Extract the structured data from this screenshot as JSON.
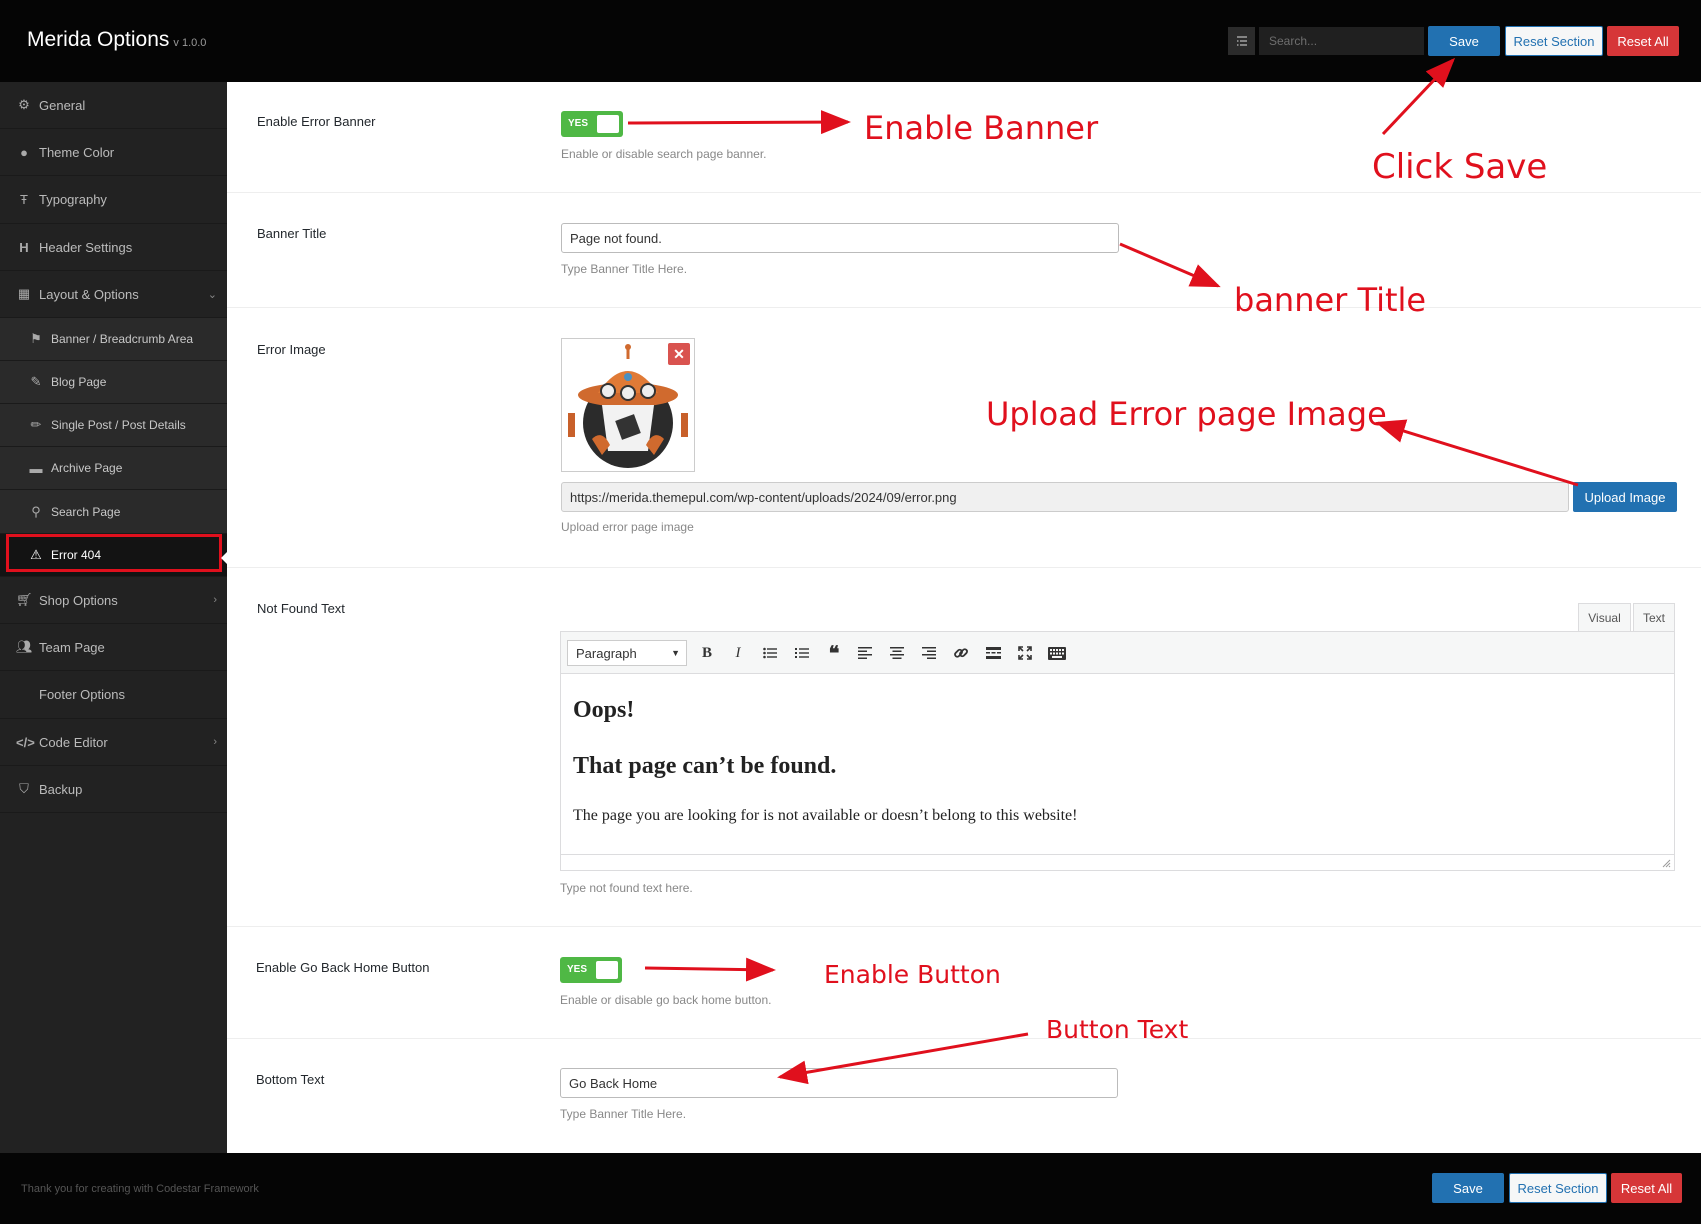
{
  "header": {
    "brand": "Merida Options",
    "version": "v 1.0.0",
    "search_placeholder": "Search...",
    "save_label": "Save",
    "reset_section_label": "Reset Section",
    "reset_all_label": "Reset All"
  },
  "sidebar": {
    "items": [
      {
        "label": "General",
        "icon": "gears-icon"
      },
      {
        "label": "Theme Color",
        "icon": "palette-icon"
      },
      {
        "label": "Typography",
        "icon": "text-height-icon"
      },
      {
        "label": "Header Settings",
        "icon": "heading-icon"
      },
      {
        "label": "Layout & Options",
        "icon": "calculator-icon"
      },
      {
        "label": "Banner / Breadcrumb Area",
        "icon": "flag-icon"
      },
      {
        "label": "Blog Page",
        "icon": "edit-icon"
      },
      {
        "label": "Single Post / Post Details",
        "icon": "pencil-icon"
      },
      {
        "label": "Archive Page",
        "icon": "archive-icon"
      },
      {
        "label": "Search Page",
        "icon": "search-icon"
      },
      {
        "label": "Error 404",
        "icon": "warning-icon"
      },
      {
        "label": "Shop Options",
        "icon": "cart-icon"
      },
      {
        "label": "Team Page",
        "icon": "users-icon"
      },
      {
        "label": "Footer Options",
        "icon": ""
      },
      {
        "label": "Code Editor",
        "icon": "code-icon"
      },
      {
        "label": "Backup",
        "icon": "shield-icon"
      }
    ]
  },
  "fields": {
    "enable_error_banner": {
      "title": "Enable Error Banner",
      "switch_label": "YES",
      "desc": "Enable or disable search page banner."
    },
    "banner_title": {
      "title": "Banner Title",
      "value": "Page not found.",
      "desc": "Type Banner Title Here."
    },
    "error_image": {
      "title": "Error Image",
      "url": "https://merida.themepul.com/wp-content/uploads/2024/09/error.png",
      "upload_label": "Upload Image",
      "desc": "Upload error page image"
    },
    "not_found_text": {
      "title": "Not Found Text",
      "tab_visual": "Visual",
      "tab_text": "Text",
      "format": "Paragraph",
      "heading1": "Oops!",
      "heading2": "That page can’t be found.",
      "paragraph": "The page you are looking for is not available or doesn’t belong to this website!",
      "desc": "Type not found text here."
    },
    "enable_go_back": {
      "title": "Enable Go Back Home Button",
      "switch_label": "YES",
      "desc": "Enable or disable go back home button."
    },
    "bottom_text": {
      "title": "Bottom Text",
      "value": "Go Back Home",
      "desc": "Type Banner Title Here."
    }
  },
  "annotations": {
    "enable_banner": "Enable Banner",
    "click_save": "Click Save",
    "banner_title": "banner Title",
    "upload_image": "Upload Error page Image",
    "enable_button": "Enable Button",
    "button_text": "Button Text"
  },
  "footer": {
    "text": "Thank you for creating with Codestar Framework",
    "save_label": "Save",
    "reset_section_label": "Reset Section",
    "reset_all_label": "Reset All"
  },
  "colors": {
    "accent": "#2271b1",
    "danger": "#d63638",
    "toggle_on": "#4fb845",
    "annotation": "#e0101d"
  }
}
